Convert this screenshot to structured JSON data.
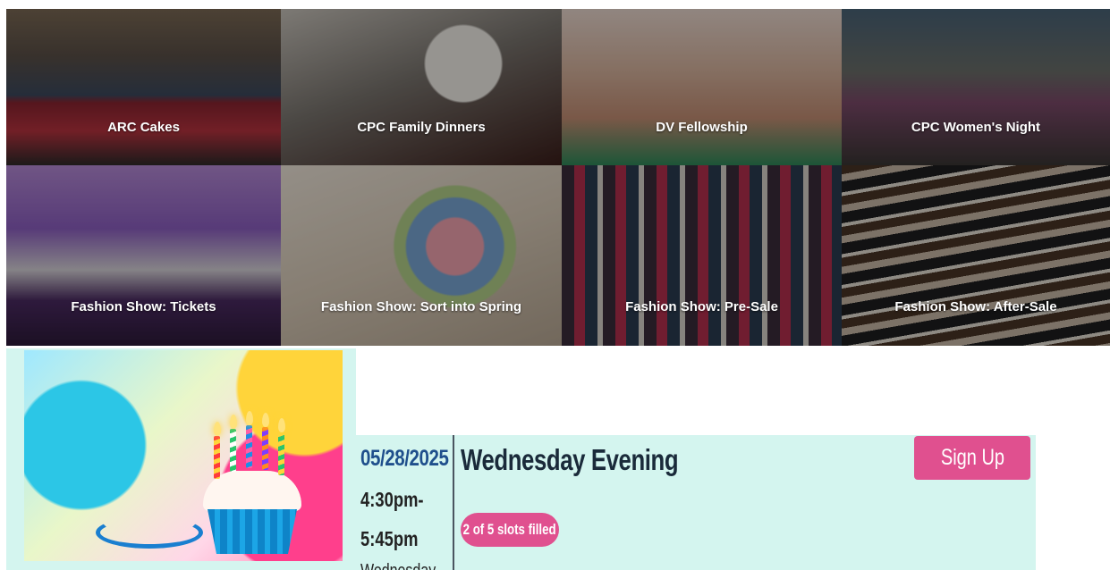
{
  "tiles": [
    {
      "label": "ARC Cakes"
    },
    {
      "label": "CPC Family Dinners"
    },
    {
      "label": "DV Fellowship"
    },
    {
      "label": "CPC Women's Night"
    },
    {
      "label": "Fashion Show: Tickets"
    },
    {
      "label": "Fashion Show: Sort into Spring"
    },
    {
      "label": "Fashion Show: Pre-Sale"
    },
    {
      "label": "Fashion Show: After-Sale"
    }
  ],
  "slot": {
    "date": "05/28/2025",
    "time_start": "4:30pm-",
    "time_end": "5:45pm",
    "day_partial": "Wednesday",
    "title": "Wednesday Evening",
    "signup_label": "Sign Up",
    "slots_filled": "2 of 5 slots filled"
  },
  "colors": {
    "accent_pink": "#e0508f",
    "panel_mint": "#d4f5ef",
    "date_blue": "#1f4f8c"
  }
}
